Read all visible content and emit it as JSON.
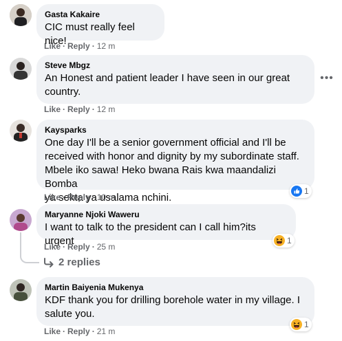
{
  "comments": [
    {
      "author": "Gasta Kakaire",
      "lines": [
        "CIC must really feel nice!"
      ],
      "like": "Like",
      "reply": "Reply",
      "time": "12 m"
    },
    {
      "author": "Steve Mbgz",
      "lines": [
        "An Honest and patient leader I have seen in our great",
        "country."
      ],
      "like": "Like",
      "reply": "Reply",
      "time": "12 m",
      "more_icon": "more-horizontal-icon"
    },
    {
      "author": "Kaysparks",
      "lines": [
        "One day I'll be a senior government official and I'll be",
        "received with honor and dignity by my subordinate staff.",
        "Mbele iko sawa! Heko bwana Rais kwa maandalizi Bomba",
        "ya sekta ya usalama nchini."
      ],
      "like": "Like",
      "reply": "Reply",
      "time": "10 m",
      "reaction": {
        "icon": "like-reaction-icon",
        "count": "1",
        "color": "#1877f2"
      }
    },
    {
      "author": "Maryanne Njoki Waweru",
      "lines": [
        "I want to talk to the president can I call him?its urgent"
      ],
      "like": "Like",
      "reply": "Reply",
      "time": "25 m",
      "reaction": {
        "icon": "haha-reaction-icon",
        "count": "1",
        "color": "#f7b125"
      },
      "replies_label": "2 replies"
    },
    {
      "author": "Martin Baiyenia Mukenya",
      "lines": [
        "KDF thank you for drilling borehole water in my village. I",
        "salute you."
      ],
      "like": "Like",
      "reply": "Reply",
      "time": "21 m",
      "reaction": {
        "icon": "haha-reaction-icon",
        "count": "1",
        "color": "#f7b125"
      }
    }
  ],
  "colors": {
    "bubble": "#f0f2f5",
    "meta": "#65676b",
    "text": "#050505"
  }
}
